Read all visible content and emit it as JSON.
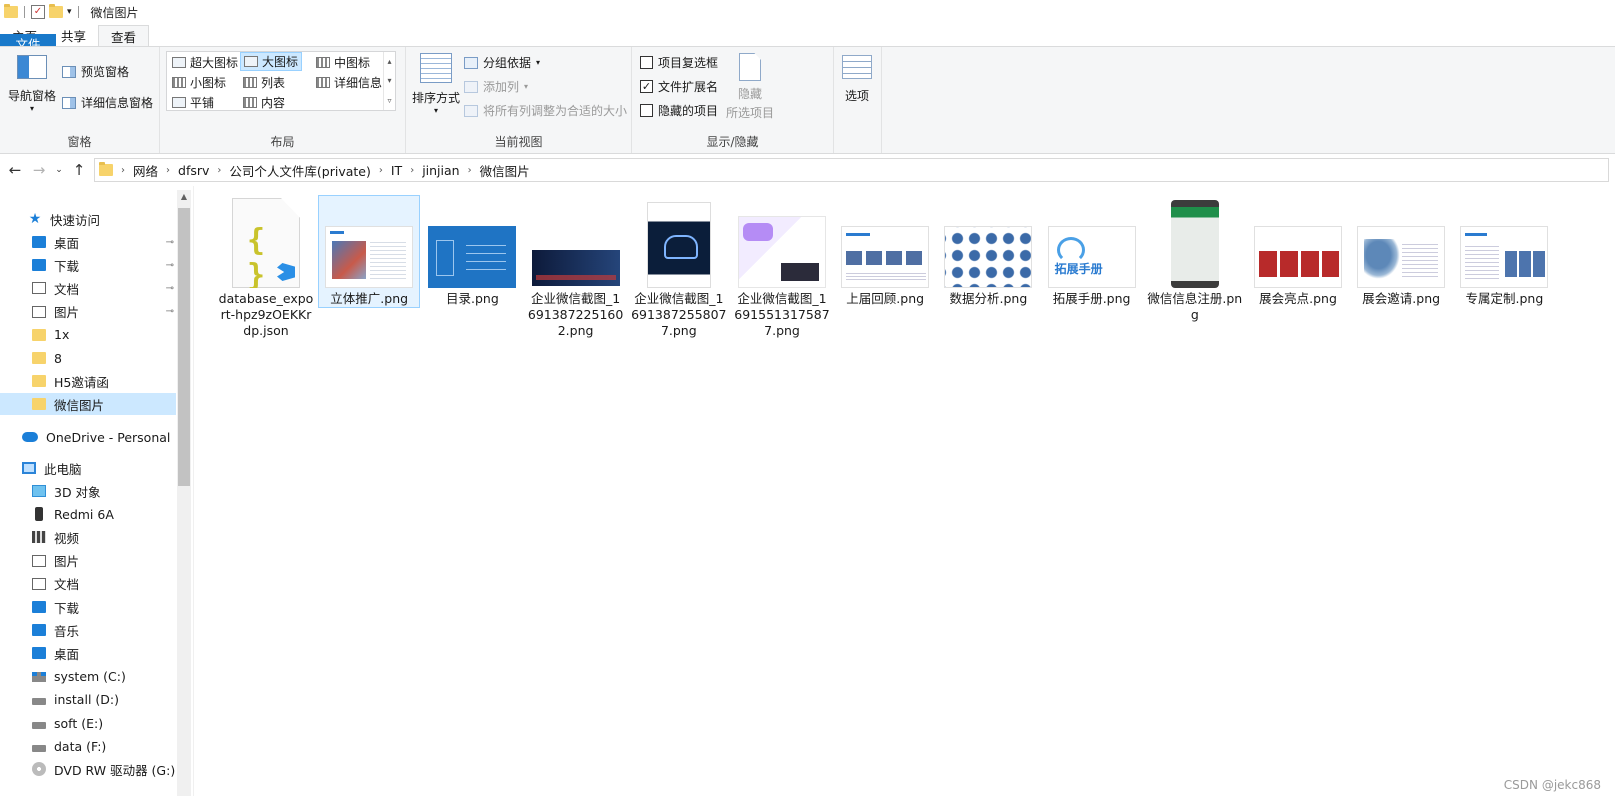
{
  "window": {
    "title": "微信图片"
  },
  "ribbon_tabs": [
    "文件",
    "主页",
    "共享",
    "查看"
  ],
  "ribbon": {
    "panes": {
      "label": "窗格",
      "nav_pane": "导航窗格",
      "preview_pane": "预览窗格",
      "details_pane": "详细信息窗格"
    },
    "layout": {
      "label": "布局",
      "items": [
        "超大图标",
        "大图标",
        "中图标",
        "小图标",
        "列表",
        "详细信息",
        "平铺",
        "内容"
      ],
      "selected": "大图标"
    },
    "current_view": {
      "label": "当前视图",
      "sort_by": "排序方式",
      "group_by": "分组依据",
      "add_columns": "添加列",
      "fit_columns": "将所有列调整为合适的大小"
    },
    "show_hide": {
      "label": "显示/隐藏",
      "item_checkboxes": {
        "label": "项目复选框",
        "checked": false
      },
      "file_extensions": {
        "label": "文件扩展名",
        "checked": true
      },
      "hidden_items": {
        "label": "隐藏的项目",
        "checked": false
      },
      "hide_selected": [
        "隐藏",
        "所选项目"
      ]
    },
    "options": {
      "label": "选项"
    }
  },
  "address": {
    "crumbs": [
      "网络",
      "dfsrv",
      "公司个人文件库(private)",
      "IT",
      "jinjian",
      "微信图片"
    ]
  },
  "sidebar": {
    "quick_access": "快速访问",
    "quick_items": [
      {
        "label": "桌面",
        "icon": "desktop-icon",
        "pinned": true
      },
      {
        "label": "下载",
        "icon": "download-icon",
        "pinned": true
      },
      {
        "label": "文档",
        "icon": "document-icon",
        "pinned": true
      },
      {
        "label": "图片",
        "icon": "pictures-icon",
        "pinned": true
      },
      {
        "label": "1x",
        "icon": "folder-icon",
        "pinned": false
      },
      {
        "label": "8",
        "icon": "folder-icon",
        "pinned": false
      },
      {
        "label": "H5邀请函",
        "icon": "folder-icon",
        "pinned": false
      },
      {
        "label": "微信图片",
        "icon": "folder-icon",
        "pinned": false,
        "selected": true
      }
    ],
    "onedrive": "OneDrive - Personal",
    "this_pc": "此电脑",
    "pc_items": [
      {
        "label": "3D 对象",
        "icon": "3d-objects-icon"
      },
      {
        "label": "Redmi 6A",
        "icon": "phone-icon"
      },
      {
        "label": "视频",
        "icon": "video-icon"
      },
      {
        "label": "图片",
        "icon": "pictures-icon"
      },
      {
        "label": "文档",
        "icon": "document-icon"
      },
      {
        "label": "下载",
        "icon": "download-icon"
      },
      {
        "label": "音乐",
        "icon": "music-icon"
      },
      {
        "label": "桌面",
        "icon": "desktop-icon"
      },
      {
        "label": "system (C:)",
        "icon": "system-drive-icon"
      },
      {
        "label": "install (D:)",
        "icon": "drive-icon"
      },
      {
        "label": "soft (E:)",
        "icon": "drive-icon"
      },
      {
        "label": "data (F:)",
        "icon": "drive-icon"
      },
      {
        "label": "DVD RW 驱动器 (G:)",
        "icon": "dvd-icon"
      }
    ]
  },
  "files": [
    {
      "name": "database_export-hpz9zOEKKrdp.json",
      "thumb": "t-json",
      "icon": "vscode-json-icon"
    },
    {
      "name": "立体推广.png",
      "thumb": "t-doc",
      "selected": true
    },
    {
      "name": "目录.png",
      "thumb": "t-blue"
    },
    {
      "name": "企业微信截图_16913872251602.png",
      "thumb": "t-dark"
    },
    {
      "name": "企业微信截图_16913872558077.png",
      "thumb": "t-cover"
    },
    {
      "name": "企业微信截图_16915513175877.png",
      "thumb": "t-adobe"
    },
    {
      "name": "上届回顾.png",
      "thumb": "t-wide"
    },
    {
      "name": "数据分析.png",
      "thumb": "t-data"
    },
    {
      "name": "拓展手册.png",
      "thumb": "t-expand"
    },
    {
      "name": "微信信息注册.png",
      "thumb": "t-phone"
    },
    {
      "name": "展会亮点.png",
      "thumb": "t-red"
    },
    {
      "name": "展会邀请.png",
      "thumb": "t-map"
    },
    {
      "name": "专属定制.png",
      "thumb": "t-custom"
    }
  ],
  "watermark": "CSDN @jekc868"
}
